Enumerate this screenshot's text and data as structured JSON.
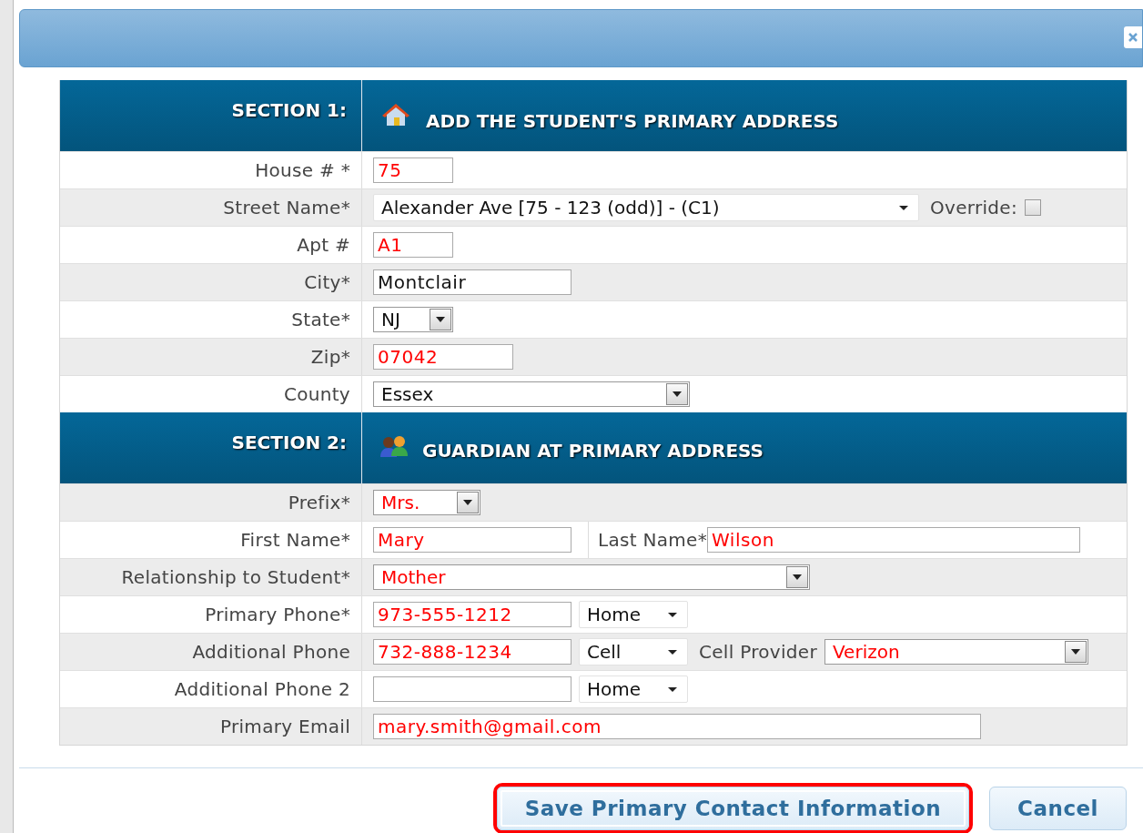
{
  "sections": [
    {
      "label": "SECTION 1:",
      "title": "ADD THE STUDENT'S PRIMARY ADDRESS",
      "rows": [
        {
          "label": "House # *",
          "fields": [
            {
              "kind": "text",
              "value": "75",
              "highlighted": true
            }
          ]
        },
        {
          "label": "Street Name*",
          "fields": [
            {
              "kind": "select",
              "value": "Alexander Ave [75 - 123 (odd)] - (C1)",
              "highlighted": false
            },
            {
              "kind": "label",
              "value": "Override:"
            },
            {
              "kind": "checkbox",
              "checked": false
            }
          ]
        },
        {
          "label": "Apt #",
          "fields": [
            {
              "kind": "text",
              "value": "A1",
              "highlighted": true
            }
          ]
        },
        {
          "label": "City*",
          "fields": [
            {
              "kind": "text",
              "value": "Montclair",
              "highlighted": false
            }
          ]
        },
        {
          "label": "State*",
          "fields": [
            {
              "kind": "dropdown",
              "value": "NJ",
              "highlighted": false
            }
          ]
        },
        {
          "label": "Zip*",
          "fields": [
            {
              "kind": "text",
              "value": "07042",
              "highlighted": true
            }
          ]
        },
        {
          "label": "County",
          "fields": [
            {
              "kind": "dropdown",
              "value": "Essex",
              "highlighted": false
            }
          ]
        }
      ]
    },
    {
      "label": "SECTION 2:",
      "title": "GUARDIAN AT PRIMARY ADDRESS",
      "rows": [
        {
          "label": "Prefix*",
          "fields": [
            {
              "kind": "dropdown",
              "value": "Mrs.",
              "highlighted": true
            }
          ]
        },
        {
          "label": "First Name*",
          "fields": [
            {
              "kind": "text",
              "value": "Mary",
              "highlighted": true
            },
            {
              "kind": "divider-label",
              "value": "Last Name*"
            },
            {
              "kind": "text",
              "value": "Wilson",
              "highlighted": true
            }
          ]
        },
        {
          "label": "Relationship to Student*",
          "fields": [
            {
              "kind": "dropdown",
              "value": "Mother",
              "highlighted": true
            }
          ]
        },
        {
          "label": "Primary Phone*",
          "fields": [
            {
              "kind": "text",
              "value": "973-555-1212",
              "highlighted": true
            },
            {
              "kind": "select",
              "value": "Home",
              "highlighted": false
            }
          ]
        },
        {
          "label": "Additional Phone",
          "fields": [
            {
              "kind": "text",
              "value": "732-888-1234",
              "highlighted": true
            },
            {
              "kind": "select",
              "value": "Cell",
              "highlighted": false
            },
            {
              "kind": "label",
              "value": "Cell Provider"
            },
            {
              "kind": "dropdown",
              "value": "Verizon",
              "highlighted": true
            }
          ]
        },
        {
          "label": "Additional Phone 2",
          "fields": [
            {
              "kind": "text"
            },
            {
              "kind": "select",
              "value": "Home",
              "highlighted": false
            }
          ]
        },
        {
          "label": "Primary Email",
          "fields": [
            {
              "kind": "text",
              "value": "mary.smith@gmail.com",
              "highlighted": true
            }
          ]
        }
      ]
    }
  ],
  "buttons": [
    {
      "label": "Save Primary Contact Information",
      "selected": true
    },
    {
      "label": "Cancel",
      "selected": false
    }
  ]
}
